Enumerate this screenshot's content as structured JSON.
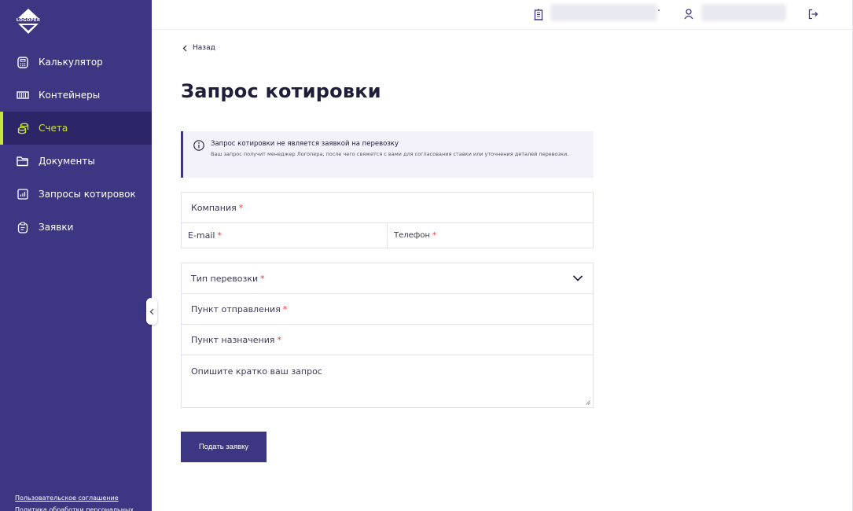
{
  "brand": {
    "logo_text": "LOGOPER"
  },
  "sidebar": {
    "items": [
      {
        "label": "Калькулятор",
        "icon": "calculator-icon"
      },
      {
        "label": "Контейнеры",
        "icon": "container-icon"
      },
      {
        "label": "Счета",
        "icon": "coins-icon",
        "active": true
      },
      {
        "label": "Документы",
        "icon": "folder-icon"
      },
      {
        "label": "Запросы котировок",
        "icon": "chart-icon"
      },
      {
        "label": "Заявки",
        "icon": "clipboard-icon"
      }
    ],
    "footer_links": [
      "Пользовательское соглашение",
      "Политика обработки персональных"
    ]
  },
  "topbar": {
    "company_icon": "building-icon",
    "user_icon": "user-icon",
    "logout_icon": "logout-icon"
  },
  "main": {
    "back_label": "Назад",
    "title": "Запрос котировки",
    "notice": {
      "title": "Запрос котировки не является заявкой на перевозку",
      "text": "Ваш запрос получит менеджер Логопера, после чего свяжется с вами для согласования ставки или уточнения деталей перевозки."
    },
    "form": {
      "company_label": "Компания",
      "email_label": "E-mail",
      "phone_label": "Телефон",
      "transport_type_label": "Тип перевозки",
      "origin_label": "Пункт отправления",
      "destination_label": "Пункт назначения",
      "description_placeholder": "Опишите кратко ваш запрос",
      "required_mark": "*",
      "submit_label": "Подать заявку"
    }
  },
  "colors": {
    "sidebar_bg": "#3d3683",
    "sidebar_active_bg": "#2c2668",
    "accent": "#c7e33c",
    "required": "#e23b3b"
  }
}
